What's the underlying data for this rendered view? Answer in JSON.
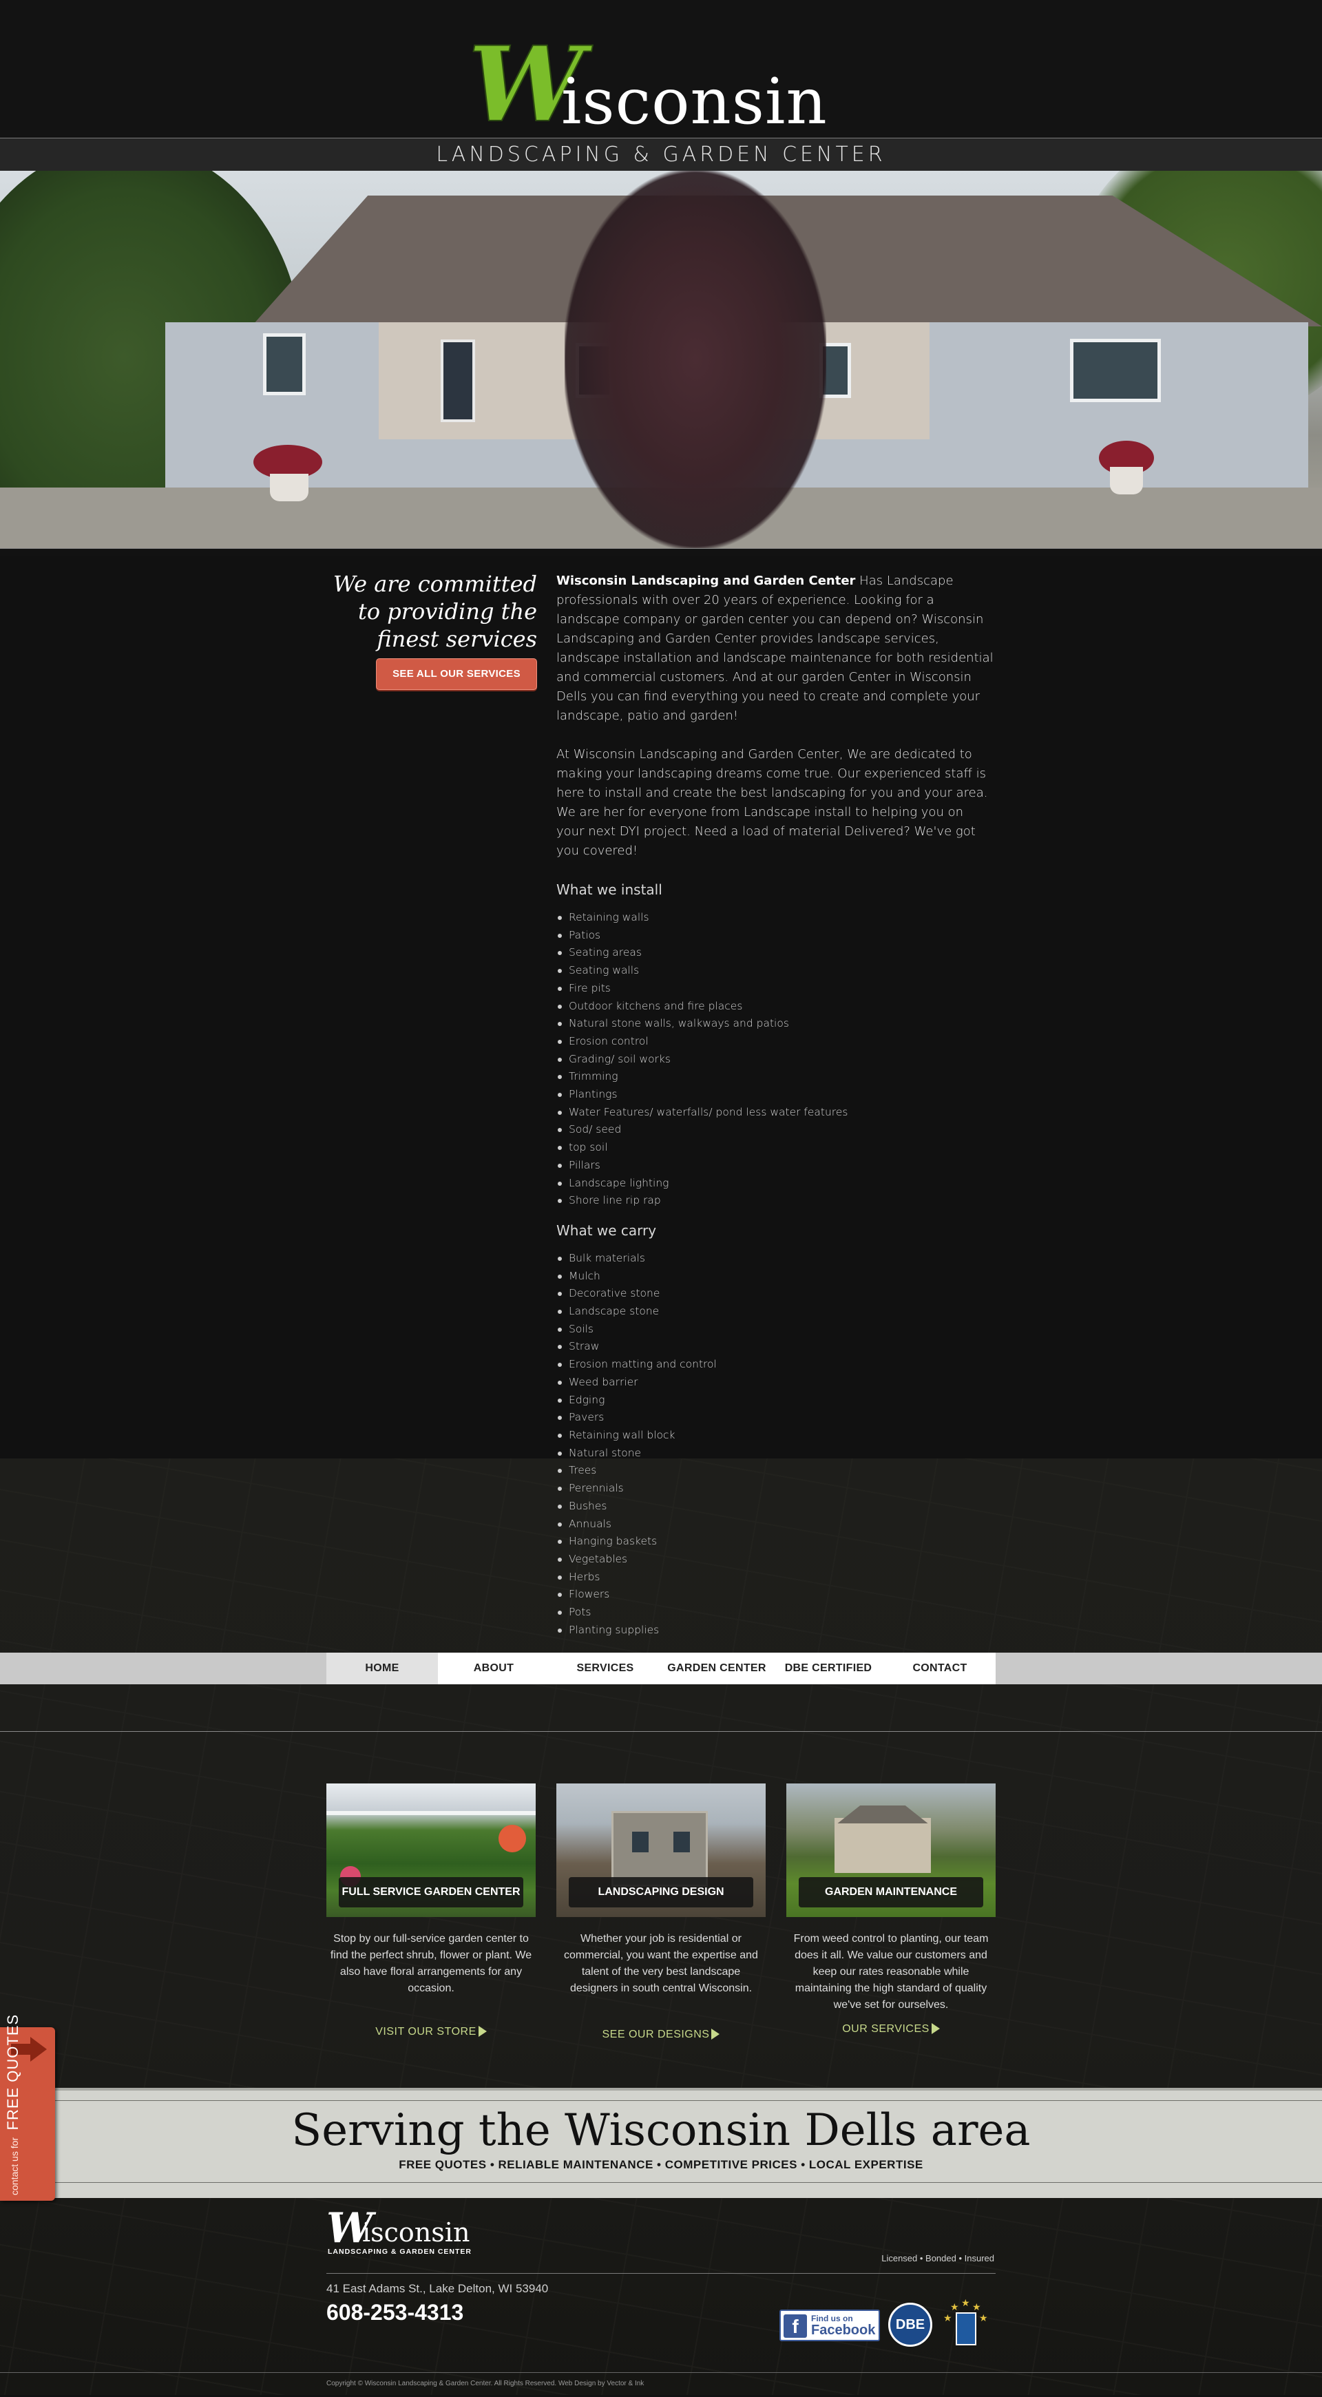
{
  "header": {
    "logo_W": "W",
    "logo_rest": "isconsin",
    "tagline": "LANDSCAPING & GARDEN CENTER"
  },
  "hero": {
    "image": "house-with-landscaping-photo"
  },
  "intro": {
    "commitment": "We are committed to providing the finest services",
    "services_button": "SEE ALL OUR SERVICES",
    "paragraph1_lead": "Wisconsin Landscaping and Garden Center",
    "paragraph1": "  Has Landscape professionals with over 20 years of experience.  Looking for a landscape company or garden center you can depend on? Wisconsin Landscaping and Garden Center provides landscape services, landscape installation and landscape maintenance for both  residential and commercial customers.  And at our garden Center in Wisconsin Dells you can find everything you need to create and complete your landscape, patio and garden!",
    "paragraph2": "At Wisconsin Landscaping and Garden Center, We are dedicated to making your landscaping dreams come true.  Our experienced staff is here to install and create the best landscaping for you and your area.  We are her for everyone from Landscape install to helping you on your next DYI project.  Need a load of material Delivered? We've got you covered!",
    "install_heading": "What we install",
    "install_items": [
      "Retaining walls",
      "Patios",
      "Seating areas",
      "Seating walls",
      "Fire pits",
      "Outdoor kitchens and fire places",
      "Natural stone walls, walkways and patios",
      "Erosion control",
      "Grading/ soil works",
      "Trimming",
      "Plantings",
      "Water Features/ waterfalls/ pond less water features",
      "Sod/ seed",
      "top soil",
      "Pillars",
      "Landscape lighting",
      "Shore line rip rap"
    ],
    "carry_heading": "What we carry",
    "carry_items": [
      "Bulk materials",
      "Mulch",
      "Decorative stone",
      "Landscape stone",
      "Soils",
      "Straw",
      "Erosion matting and control",
      "Weed barrier",
      "Edging",
      "Pavers",
      "Retaining wall block",
      "Natural stone",
      "Trees",
      "Perennials",
      "Bushes",
      "Annuals",
      "Hanging baskets",
      "Vegetables",
      "Herbs",
      "Flowers",
      "Pots",
      "Planting supplies"
    ]
  },
  "nav": {
    "items": [
      "HOME",
      "ABOUT",
      "SERVICES",
      "GARDEN CENTER",
      "DBE CERTIFIED",
      "CONTACT"
    ],
    "active": "HOME"
  },
  "cards": [
    {
      "label": "FULL SERVICE GARDEN CENTER",
      "description": "Stop by our full-service garden center to find the perfect shrub, flower or plant. We also have floral arrangements for any occasion.",
      "link": "VISIT OUR STORE"
    },
    {
      "label": "LANDSCAPING DESIGN",
      "description": "Whether your job is residential or commercial, you want the expertise and talent of the very best landscape designers in south central Wisconsin.",
      "link": "SEE OUR DESIGNS"
    },
    {
      "label": "GARDEN MAINTENANCE",
      "description": "From weed control to planting, our team does it all. We value our customers and keep our rates reasonable while maintaining the high standard of quality we've set for ourselves.",
      "link": "OUR SERVICES"
    }
  ],
  "serving": {
    "title": "Serving the Wisconsin Dells area",
    "subtitle": "FREE QUOTES • RELIABLE MAINTENANCE • COMPETITIVE PRICES • LOCAL EXPERTISE"
  },
  "footer": {
    "logo_W": "W",
    "logo_rest": "isconsin",
    "logo_tag": "LANDSCAPING & GARDEN CENTER",
    "licensed": "Licensed • Bonded • Insured",
    "address": "41 East Adams St., Lake Delton, WI 53940",
    "phone": "608-253-4313",
    "facebook_find": "Find us on",
    "facebook_name": "Facebook",
    "dbe": "DBE",
    "copyright": "Copyright © Wisconsin Landscaping & Garden Center. All Rights Reserved. Web Design by Vector & Ink"
  },
  "quote_tab": {
    "small": "contact us for",
    "big": "FREE QUOTES"
  },
  "colors": {
    "accent_green": "#7bbd2a",
    "button_red": "#d05a45",
    "link_green": "#c7d98b",
    "background": "#121212"
  }
}
